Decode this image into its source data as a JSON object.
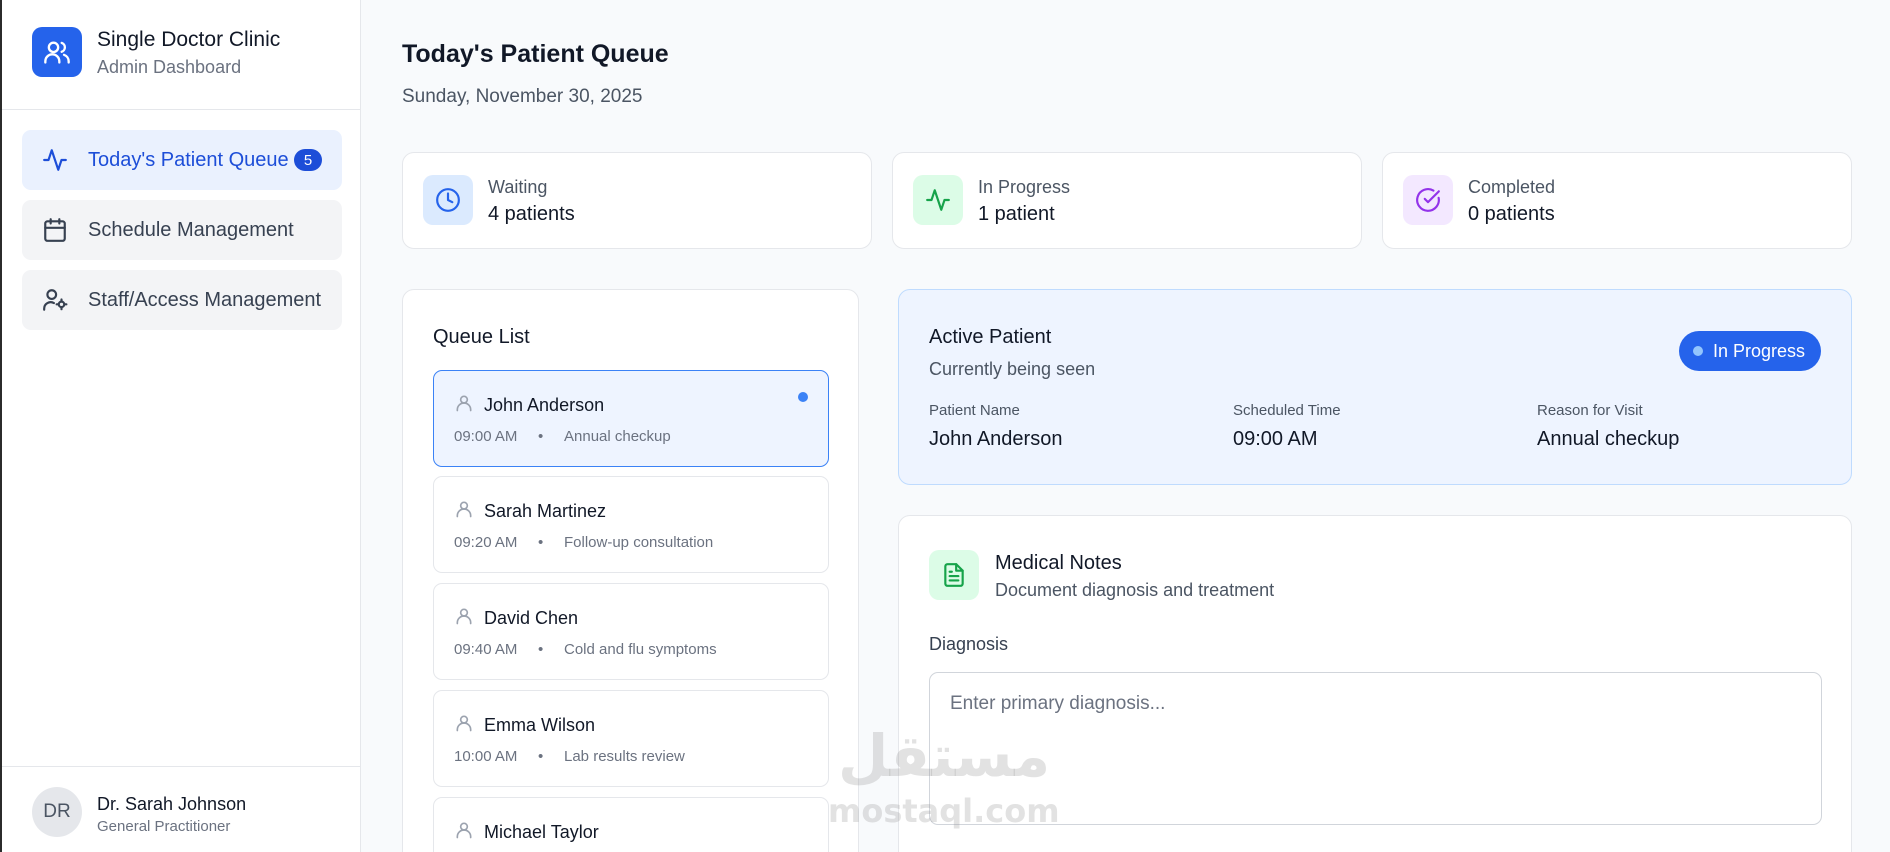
{
  "brand": {
    "title": "Single Doctor Clinic",
    "subtitle": "Admin Dashboard",
    "icon": "users-icon",
    "color": "#2563eb"
  },
  "sidebar": {
    "items": [
      {
        "label": "Today's Patient Queue",
        "icon": "activity-icon",
        "badge": "5",
        "active": true
      },
      {
        "label": "Schedule Management",
        "icon": "calendar-icon",
        "active": false
      },
      {
        "label": "Staff/Access Management",
        "icon": "user-cog-icon",
        "active": false
      }
    ]
  },
  "user": {
    "initials": "DR",
    "name": "Dr. Sarah Johnson",
    "role": "General Practitioner"
  },
  "header": {
    "title": "Today's Patient Queue",
    "date": "Sunday, November 30, 2025"
  },
  "stats": [
    {
      "label": "Waiting",
      "value": "4 patients",
      "icon": "clock-icon",
      "color": "#2563eb",
      "bg": "#dbeafe"
    },
    {
      "label": "In Progress",
      "value": "1 patient",
      "icon": "activity-icon",
      "color": "#16a34a",
      "bg": "#dcfce7"
    },
    {
      "label": "Completed",
      "value": "0 patients",
      "icon": "check-circle-icon",
      "color": "#9333ea",
      "bg": "#f3e8ff"
    }
  ],
  "queue": {
    "title": "Queue List",
    "items": [
      {
        "name": "John Anderson",
        "time": "09:00 AM",
        "separator": "•",
        "reason": "Annual checkup",
        "active": true
      },
      {
        "name": "Sarah Martinez",
        "time": "09:20 AM",
        "separator": "•",
        "reason": "Follow-up consultation",
        "active": false
      },
      {
        "name": "David Chen",
        "time": "09:40 AM",
        "separator": "•",
        "reason": "Cold and flu symptoms",
        "active": false
      },
      {
        "name": "Emma Wilson",
        "time": "10:00 AM",
        "separator": "•",
        "reason": "Lab results review",
        "active": false
      },
      {
        "name": "Michael Taylor",
        "time": "",
        "separator": "",
        "reason": "",
        "active": false
      }
    ]
  },
  "active_patient": {
    "title": "Active Patient",
    "subtitle": "Currently being seen",
    "status": "In Progress",
    "fields": [
      {
        "label": "Patient Name",
        "value": "John Anderson"
      },
      {
        "label": "Scheduled Time",
        "value": "09:00 AM"
      },
      {
        "label": "Reason for Visit",
        "value": "Annual checkup"
      }
    ]
  },
  "notes": {
    "title": "Medical Notes",
    "subtitle": "Document diagnosis and treatment",
    "icon": "file-text-icon",
    "diagnosis_label": "Diagnosis",
    "diagnosis_placeholder": "Enter primary diagnosis...",
    "diagnosis_value": ""
  },
  "watermark": {
    "arabic": "مستقل",
    "latin": "mostaql.com"
  }
}
